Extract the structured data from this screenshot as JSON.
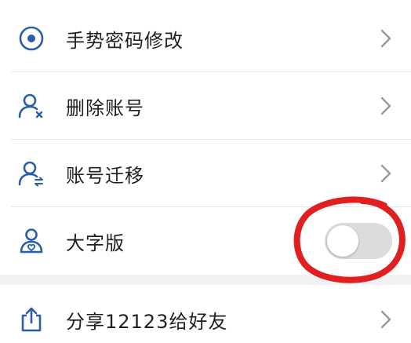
{
  "colors": {
    "icon_blue": "#2a5ea8",
    "chevron": "#9a9a9a",
    "annotation_red": "#e02020",
    "toggle_track": "#dcdcdf"
  },
  "settings": {
    "items": [
      {
        "label": "手势密码修改",
        "icon": "target-icon",
        "trailing": "chevron-right-icon"
      },
      {
        "label": "删除账号",
        "icon": "user-remove-icon",
        "trailing": "chevron-right-icon"
      },
      {
        "label": "账号迁移",
        "icon": "user-transfer-icon",
        "trailing": "chevron-right-icon"
      },
      {
        "label": "大字版",
        "icon": "user-heart-icon",
        "trailing": "toggle",
        "toggle_on": false
      }
    ]
  },
  "share": {
    "label": "分享12123给好友",
    "icon": "share-icon",
    "trailing": "chevron-right-icon"
  },
  "annotation": {
    "shape": "red-circle",
    "target": "large-font-toggle"
  }
}
